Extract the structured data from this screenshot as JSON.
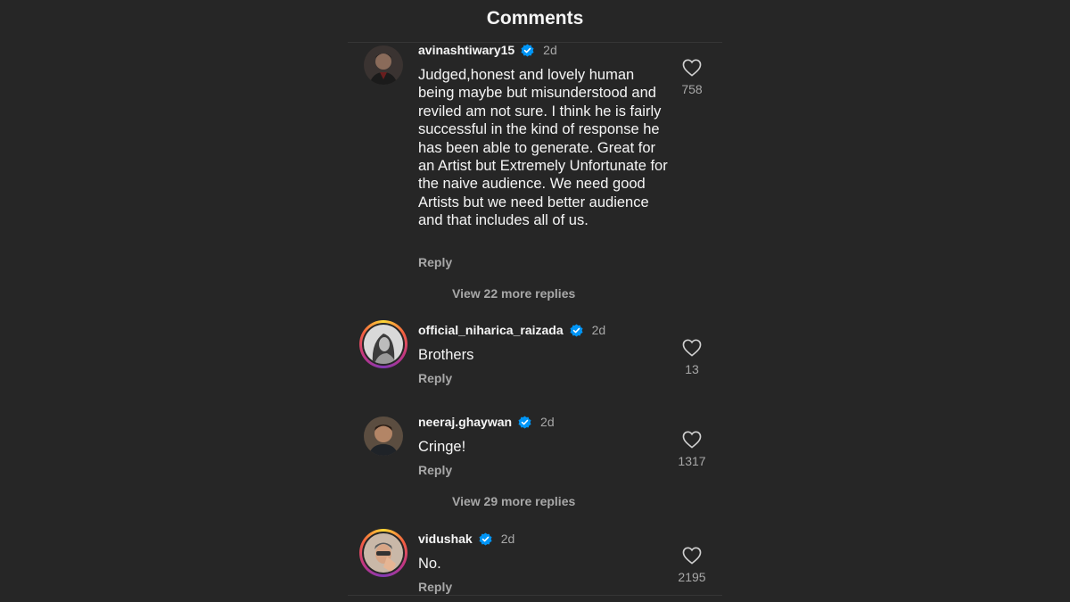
{
  "header": {
    "title": "Comments"
  },
  "comments": [
    {
      "username": "avinashtiwary15",
      "verified": true,
      "time": "2d",
      "text": "Judged,honest and lovely human being maybe but misunderstood and reviled am not sure. I think he is fairly successful in the kind of response he has been able to generate. Great for an Artist but Extremely Unfortunate for the naive audience. We need good Artists but we need better audience and that includes all of us.",
      "reply_label": "Reply",
      "likes": "758",
      "view_replies": "View 22 more replies"
    },
    {
      "username": "official_niharica_raizada",
      "verified": true,
      "time": "2d",
      "text": "Brothers",
      "reply_label": "Reply",
      "likes": "13"
    },
    {
      "username": "neeraj.ghaywan",
      "verified": true,
      "time": "2d",
      "text": "Cringe!",
      "reply_label": "Reply",
      "likes": "1317",
      "view_replies": "View 29 more replies"
    },
    {
      "username": "vidushak",
      "verified": true,
      "time": "2d",
      "text": "No.",
      "reply_label": "Reply",
      "likes": "2195"
    }
  ],
  "icons": {
    "like": "heart-icon",
    "verified": "verified-badge-icon"
  },
  "colors": {
    "background": "#262626",
    "verified": "#0095f6",
    "muted": "#a8a8a8"
  }
}
